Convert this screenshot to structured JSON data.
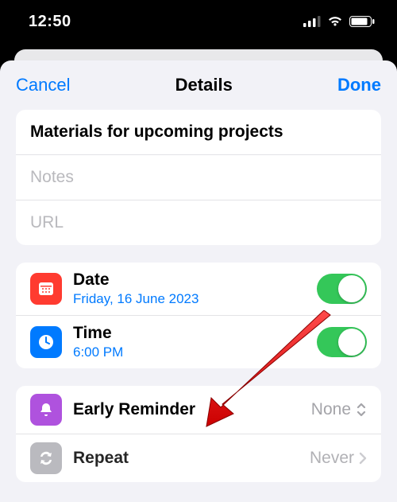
{
  "status": {
    "time": "12:50"
  },
  "nav": {
    "cancel": "Cancel",
    "title": "Details",
    "done": "Done"
  },
  "reminder": {
    "title": "Materials for upcoming projects",
    "notes_placeholder": "Notes",
    "url_placeholder": "URL"
  },
  "rows": {
    "date": {
      "label": "Date",
      "sub": "Friday, 16 June 2023",
      "on": true
    },
    "time": {
      "label": "Time",
      "sub": "6:00 PM",
      "on": true
    },
    "early": {
      "label": "Early Reminder",
      "value": "None"
    },
    "repeat": {
      "label": "Repeat",
      "value": "Never"
    }
  }
}
